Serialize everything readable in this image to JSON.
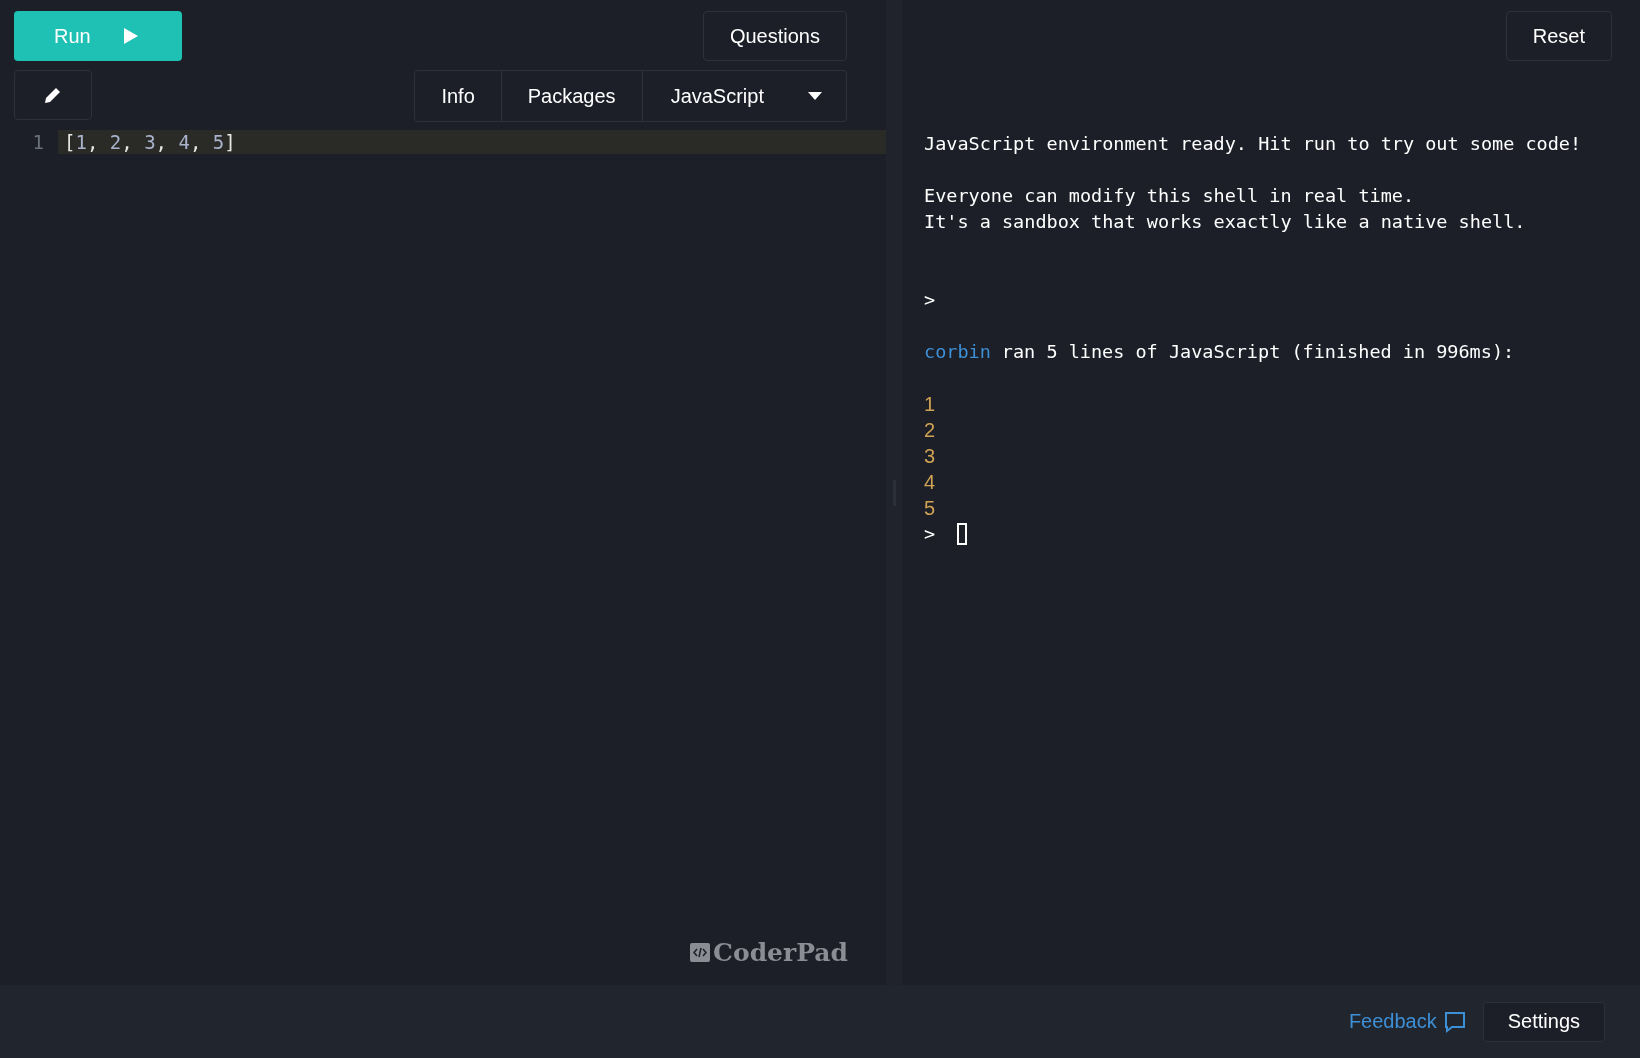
{
  "toolbar": {
    "run_button": "Run",
    "questions_button": "Questions"
  },
  "editor_tabs": [
    {
      "label": "Info",
      "kind": "tab"
    },
    {
      "label": "Packages",
      "kind": "tab"
    },
    {
      "label": "JavaScript",
      "kind": "dropdown"
    }
  ],
  "editor": {
    "lines": [
      {
        "number": "1",
        "highlighted": true,
        "tokens": [
          {
            "text": "[",
            "kind": "punct"
          },
          {
            "text": "1",
            "kind": "number"
          },
          {
            "text": ", ",
            "kind": "punct"
          },
          {
            "text": "2",
            "kind": "number"
          },
          {
            "text": ", ",
            "kind": "punct"
          },
          {
            "text": "3",
            "kind": "number"
          },
          {
            "text": ", ",
            "kind": "punct"
          },
          {
            "text": "4",
            "kind": "number"
          },
          {
            "text": ", ",
            "kind": "punct"
          },
          {
            "text": "5",
            "kind": "number"
          },
          {
            "text": "]",
            "kind": "punct"
          }
        ]
      }
    ],
    "logo": "CoderPad"
  },
  "console": {
    "reset_button": "Reset",
    "lines": [
      {
        "kind": "text",
        "text": "JavaScript environment ready. Hit run to try out some code!"
      },
      {
        "kind": "blank"
      },
      {
        "kind": "text",
        "text": "Everyone can modify this shell in real time."
      },
      {
        "kind": "text",
        "text": "It's a sandbox that works exactly like a native shell."
      },
      {
        "kind": "blank"
      },
      {
        "kind": "blank"
      },
      {
        "kind": "prompt",
        "text": ">",
        "cursor": false
      },
      {
        "kind": "blank"
      },
      {
        "kind": "run-info",
        "user": "corbin",
        "text": "ran 5 lines of JavaScript (finished in 996ms):"
      },
      {
        "kind": "blank"
      },
      {
        "kind": "output",
        "text": "1"
      },
      {
        "kind": "output",
        "text": "2"
      },
      {
        "kind": "output",
        "text": "3"
      },
      {
        "kind": "output",
        "text": "4"
      },
      {
        "kind": "output",
        "text": "5"
      },
      {
        "kind": "prompt",
        "text": ">",
        "cursor": true
      }
    ]
  },
  "footer": {
    "feedback_link": "Feedback",
    "settings_button": "Settings"
  }
}
